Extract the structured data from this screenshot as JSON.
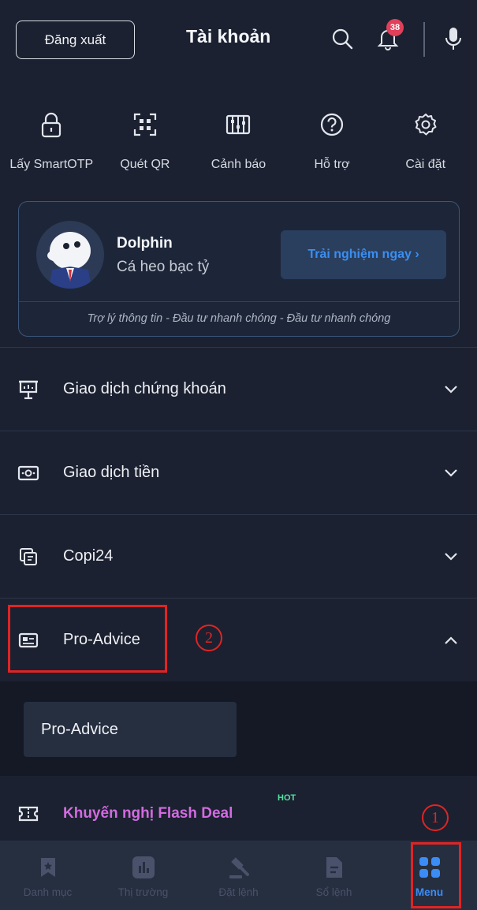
{
  "header": {
    "logout_label": "Đăng xuất",
    "title": "Tài khoản",
    "notification_count": "38"
  },
  "quick_actions": [
    {
      "label": "Lấy SmartOTP",
      "icon": "lock-icon"
    },
    {
      "label": "Quét QR",
      "icon": "qr-scan-icon"
    },
    {
      "label": "Cảnh báo",
      "icon": "sliders-icon"
    },
    {
      "label": "Hỗ trợ",
      "icon": "help-icon"
    },
    {
      "label": "Cài đặt",
      "icon": "gear-icon"
    }
  ],
  "dolphin": {
    "name": "Dolphin",
    "subtitle": "Cá heo bạc tỷ",
    "cta_label": "Trải nghiệm ngay ›",
    "tagline": "Trợ lý thông tin - Đầu tư nhanh chóng - Đầu tư nhanh chóng"
  },
  "menu": {
    "items": [
      {
        "label": "Giao dịch chứng khoán",
        "icon": "presentation-icon",
        "expanded": false
      },
      {
        "label": "Giao dịch tiền",
        "icon": "cash-icon",
        "expanded": false
      },
      {
        "label": "Copi24",
        "icon": "copy-icon",
        "expanded": false
      },
      {
        "label": "Pro-Advice",
        "icon": "id-card-icon",
        "expanded": true
      }
    ],
    "pro_advice_sub": [
      "Pro-Advice"
    ],
    "flash_deal": {
      "label": "Khuyến nghị Flash Deal",
      "badge": "HOT",
      "icon": "ticket-icon"
    }
  },
  "annotations": {
    "step1": "1",
    "step2": "2"
  },
  "bottom_nav": [
    {
      "label": "Danh mục",
      "icon": "bookmark-icon",
      "active": false
    },
    {
      "label": "Thị trường",
      "icon": "bar-chart-icon",
      "active": false
    },
    {
      "label": "Đặt lệnh",
      "icon": "gavel-icon",
      "active": false
    },
    {
      "label": "Sổ lệnh",
      "icon": "document-icon",
      "active": false
    },
    {
      "label": "Menu",
      "icon": "grid-icon",
      "active": true
    }
  ],
  "colors": {
    "background": "#1b2130",
    "accent": "#3c8cf5",
    "badge": "#e0405a",
    "flash_deal": "#d36be0",
    "hot": "#52e3a0",
    "annotation": "#e02424"
  }
}
